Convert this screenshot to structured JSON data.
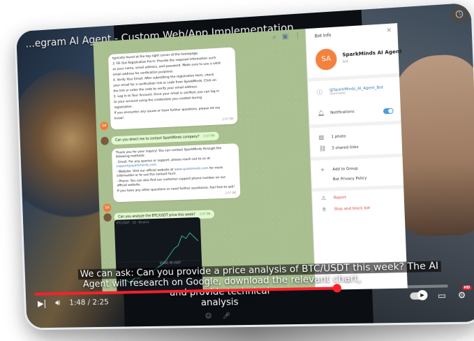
{
  "video": {
    "title": "...egram AI Agent - Custom Web/App Implementation",
    "current_time": "1:48",
    "separator": "/",
    "duration": "2:25",
    "progress": 0.745,
    "caption_line1": "We can ask: Can you provide a price analysis of BTC/USDT this week? The AI",
    "caption_line2": "Agent will research on Google, download the relevant chart, and provide technical",
    "caption_line3": "analysis",
    "hd_badge": "HD"
  },
  "chat": {
    "avatar_initials": "SA",
    "msg1_lines": [
      "typically found at the top right corner of the homepage.",
      "3. Fill Out Registration Form: Provide the required information such",
      "as your name, email address, and password. Make sure to use a valid",
      "email address for verification purposes.",
      "4. Verify Your Email: After submitting the registration form, check",
      "your email for a verification link or code from SparkMinds. Click on",
      "the link or enter the code to verify your email address.",
      "5. Log In to Your Account: Once your email is verified, you can log in",
      "to your account using the credentials you created during",
      "registration.",
      "If you encounter any issues or have further questions, please let me",
      "know!"
    ],
    "msg1_time": "2:07 PM",
    "out1": "Can you direct me to contact SparkMinds company?",
    "out1_time": "2:07 PM",
    "msg2_intro": "Thank you for your inquiry! You can contact SparkMinds through the following methods:",
    "msg2_email": "- Email: For any queries or support, please reach out to us at",
    "msg2_email_addr": "support@sparkminds.com.",
    "msg2_web": "- Website: Visit our official website at",
    "msg2_web_addr": "www.sparkminds.com",
    "msg2_web_tail": "for more information or to use the contact form.",
    "msg2_phone": "- Phone: You can also find our customer support phone number on our official website.",
    "msg2_close": "If you have any other questions or need further assistance, feel free to ask!",
    "msg2_time": "2:07 PM",
    "out2": "Can you analyze the BTC/USDT price this week?",
    "out2_time": "2:07 PM",
    "chart_header": "BTC/USDT · 1D · Binance",
    "chart_price_label": "67481.09 USDT"
  },
  "sidebar": {
    "header": "Bot Info",
    "avatar_initials": "SA",
    "bot_name": "SparkMinds AI Agent",
    "bot_sub": "bot",
    "username": "@SparkMinds_AI_Agent_Bot",
    "username_label": "Username",
    "notifications": "Notifications",
    "photos": "1 photo",
    "links": "3 shared links",
    "add_to_group": "Add to Group",
    "privacy_policy": "Bot Privacy Policy",
    "report": "Report",
    "stop_block": "Stop and block bot"
  },
  "colors": {
    "accent": "#ff1f2a",
    "telegram_blue": "#4a9de0",
    "avatar_orange": "#f3823f",
    "chat_bg": "#a9bf90",
    "danger": "#e0483e"
  }
}
